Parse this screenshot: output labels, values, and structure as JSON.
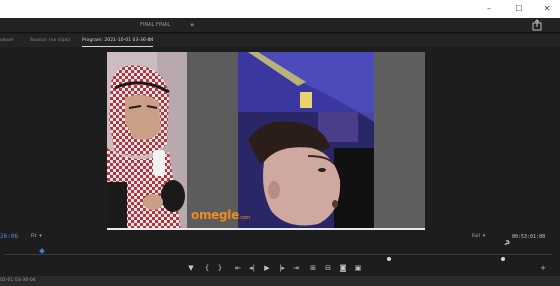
{
  "window": {
    "title": "FINAL FINAL",
    "more_label": "»",
    "controls": [
      "–",
      "☐",
      "✕"
    ]
  },
  "panel_tabs": [
    {
      "label": "owser",
      "active": false
    },
    {
      "label": "Source: (no clips)",
      "active": false
    },
    {
      "label": "Program: 2021-10-01 03-36-04",
      "active": true
    }
  ],
  "panel_menu_label": "≡",
  "video": {
    "brand": "omegle",
    "brand_suffix": ".com"
  },
  "controls": {
    "current_timecode": "26:06",
    "fit_value": "Fit",
    "resolution_value": "Full",
    "duration_timecode": "00:53:01:08"
  },
  "scrub": {
    "playhead_fraction": 0.065
  },
  "status": {
    "timecode": "02-01 03-36-04"
  },
  "colors": {
    "accent_blue": "#4f8fd8",
    "brand_orange": "#f08c1e",
    "panel_bg": "#1d1d1d"
  }
}
